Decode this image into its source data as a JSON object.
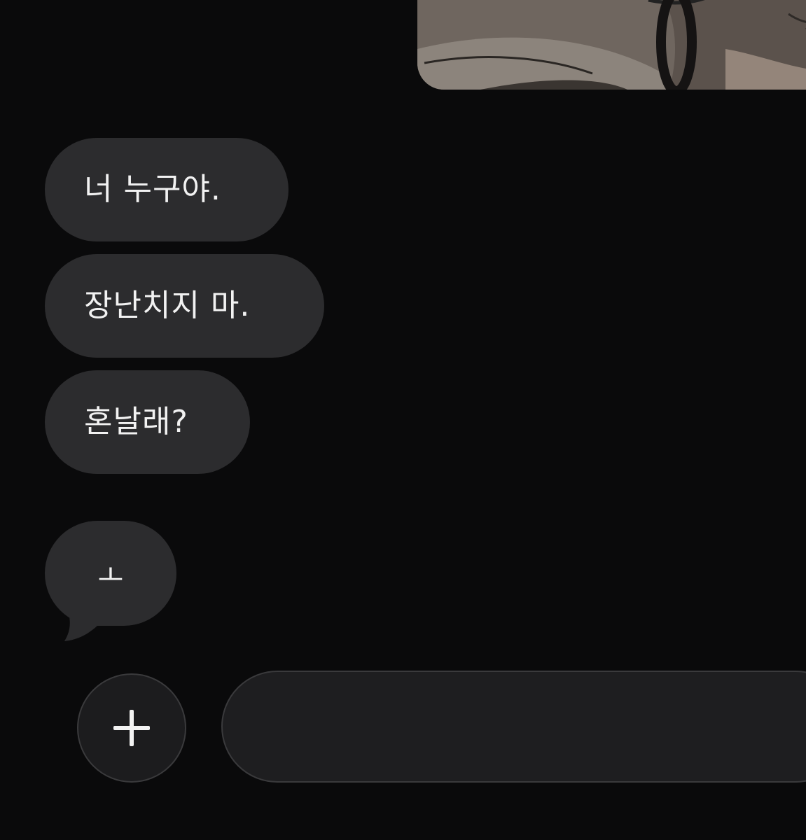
{
  "chat": {
    "messages": [
      {
        "text": "너 누구야."
      },
      {
        "text": "장난치지 마."
      },
      {
        "text": "혼날래?"
      },
      {
        "text": "ㅗ"
      }
    ]
  },
  "composer": {
    "add_label": "+",
    "input_value": "",
    "input_placeholder": ""
  },
  "colors": {
    "background": "#0a0a0b",
    "bubble": "#2c2c2e",
    "text": "#f2f2f2"
  }
}
